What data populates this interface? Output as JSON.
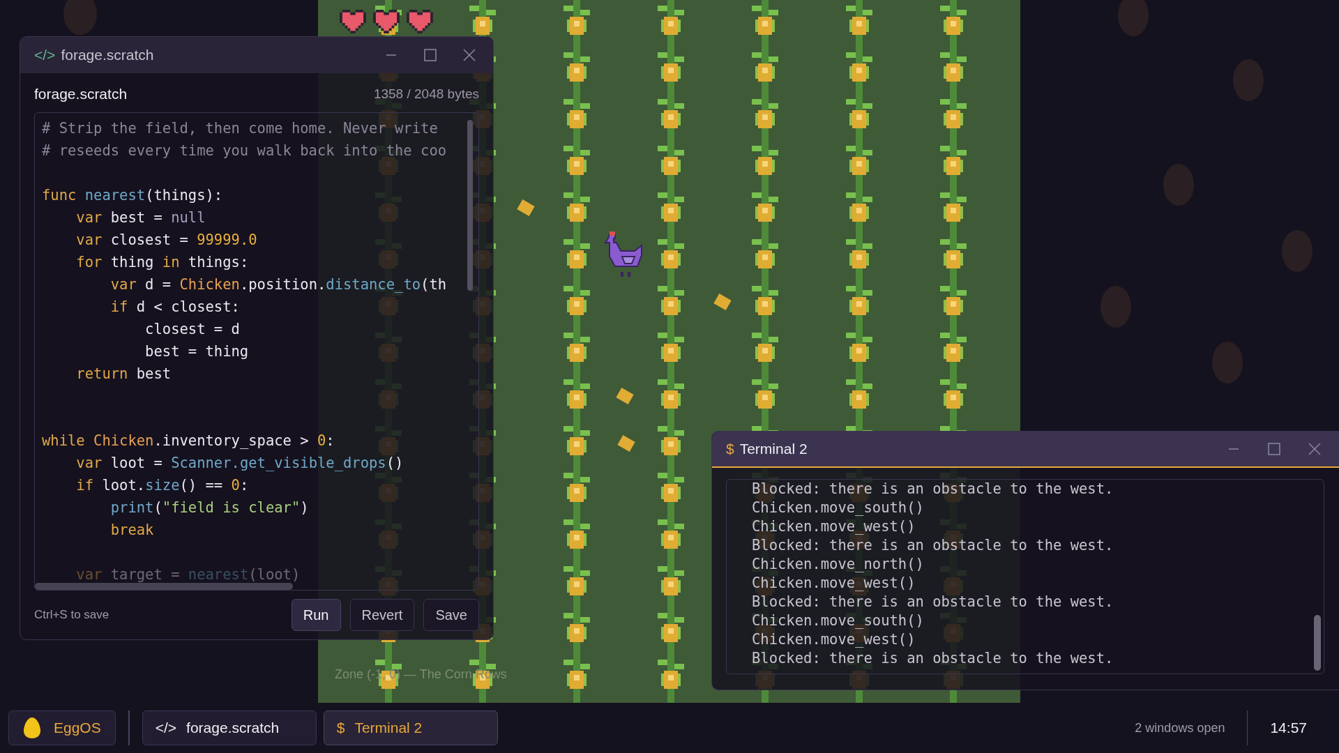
{
  "zone_label": "Zone (-1, 0) — The Corn Rows",
  "editor_window": {
    "title_icon": "</>",
    "title": "forage.scratch",
    "file_name": "forage.scratch",
    "size": "1358 / 2048 bytes",
    "code_lines": [
      {
        "kind": "code",
        "tokens": [
          {
            "kind": "comment",
            "text": "# Strip the field, then come home. Never write"
          }
        ]
      },
      {
        "kind": "code",
        "tokens": [
          {
            "kind": "comment",
            "text": "# reseeds every time you walk back into the coo"
          }
        ]
      },
      {
        "kind": "blank"
      },
      {
        "kind": "code",
        "tokens": [
          {
            "kind": "keyword",
            "text": "func "
          },
          {
            "kind": "function",
            "text": "nearest"
          },
          {
            "kind": "plain",
            "text": "(things):"
          }
        ]
      },
      {
        "kind": "code",
        "tokens": [
          {
            "kind": "keyword",
            "text": "    var"
          },
          {
            "kind": "plain",
            "text": " best = "
          },
          {
            "kind": "constant",
            "text": "null"
          }
        ]
      },
      {
        "kind": "code",
        "tokens": [
          {
            "kind": "keyword",
            "text": "    var"
          },
          {
            "kind": "plain",
            "text": " closest = "
          },
          {
            "kind": "number",
            "text": "99999.0"
          }
        ]
      },
      {
        "kind": "code",
        "tokens": [
          {
            "kind": "keyword",
            "text": "    for"
          },
          {
            "kind": "plain",
            "text": " thing "
          },
          {
            "kind": "keyword",
            "text": "in"
          },
          {
            "kind": "plain",
            "text": " things:"
          }
        ]
      },
      {
        "kind": "code",
        "tokens": [
          {
            "kind": "keyword",
            "text": "        var"
          },
          {
            "kind": "plain",
            "text": " d = "
          },
          {
            "kind": "class",
            "text": "Chicken"
          },
          {
            "kind": "plain",
            "text": ".position."
          },
          {
            "kind": "function",
            "text": "distance_to"
          },
          {
            "kind": "plain",
            "text": "(th"
          }
        ]
      },
      {
        "kind": "code",
        "tokens": [
          {
            "kind": "keyword",
            "text": "        if"
          },
          {
            "kind": "plain",
            "text": " d < closest:"
          }
        ]
      },
      {
        "kind": "code",
        "tokens": [
          {
            "kind": "plain",
            "text": "            closest = d"
          }
        ]
      },
      {
        "kind": "code",
        "tokens": [
          {
            "kind": "plain",
            "text": "            best = thing"
          }
        ]
      },
      {
        "kind": "code",
        "tokens": [
          {
            "kind": "keyword",
            "text": "    return"
          },
          {
            "kind": "plain",
            "text": " best"
          }
        ]
      },
      {
        "kind": "blank"
      },
      {
        "kind": "blank"
      },
      {
        "kind": "code",
        "tokens": [
          {
            "kind": "keyword",
            "text": "while "
          },
          {
            "kind": "class",
            "text": "Chicken"
          },
          {
            "kind": "plain",
            "text": ".inventory_space > "
          },
          {
            "kind": "number",
            "text": "0"
          },
          {
            "kind": "plain",
            "text": ":"
          }
        ]
      },
      {
        "kind": "code",
        "tokens": [
          {
            "kind": "keyword",
            "text": "    var"
          },
          {
            "kind": "plain",
            "text": " loot = "
          },
          {
            "kind": "function",
            "text": "Scanner.get_visible_drops"
          },
          {
            "kind": "plain",
            "text": "()"
          }
        ]
      },
      {
        "kind": "code",
        "tokens": [
          {
            "kind": "keyword",
            "text": "    if"
          },
          {
            "kind": "plain",
            "text": " loot."
          },
          {
            "kind": "function",
            "text": "size"
          },
          {
            "kind": "plain",
            "text": "() == "
          },
          {
            "kind": "number",
            "text": "0"
          },
          {
            "kind": "plain",
            "text": ":"
          }
        ]
      },
      {
        "kind": "code",
        "tokens": [
          {
            "kind": "function",
            "text": "        print"
          },
          {
            "kind": "plain",
            "text": "("
          },
          {
            "kind": "string",
            "text": "\"field is clear\""
          },
          {
            "kind": "plain",
            "text": ")"
          }
        ]
      },
      {
        "kind": "code",
        "tokens": [
          {
            "kind": "keyword",
            "text": "        break"
          }
        ]
      },
      {
        "kind": "blank"
      },
      {
        "kind": "faded",
        "tokens": [
          {
            "kind": "keyword",
            "text": "    var"
          },
          {
            "kind": "plain",
            "text": " target = "
          },
          {
            "kind": "function",
            "text": "nearest"
          },
          {
            "kind": "plain",
            "text": "(loot)"
          }
        ]
      }
    ],
    "hint": "Ctrl+S to save",
    "buttons": [
      {
        "label": "Run",
        "kind": "primary"
      },
      {
        "label": "Revert",
        "kind": "secondary"
      },
      {
        "label": "Save",
        "kind": "secondary"
      }
    ]
  },
  "terminal_window": {
    "title_icon": "$",
    "title": "Terminal 2",
    "focused": true,
    "lines": [
      "Blocked: there is an obstacle to the west.",
      "Chicken.move_south()",
      "Chicken.move_west()",
      "Blocked: there is an obstacle to the west.",
      "Chicken.move_north()",
      "Chicken.move_west()",
      "Blocked: there is an obstacle to the west.",
      "Chicken.move_south()",
      "Chicken.move_west()",
      "Blocked: there is an obstacle to the west."
    ]
  },
  "taskbar": {
    "start": "EggOS",
    "items": [
      {
        "icon": "</>",
        "label": "forage.scratch",
        "selected": false
      },
      {
        "icon": "$",
        "label": "Terminal 2",
        "selected": true
      }
    ],
    "status": "2 windows open",
    "clock": "14:57"
  }
}
